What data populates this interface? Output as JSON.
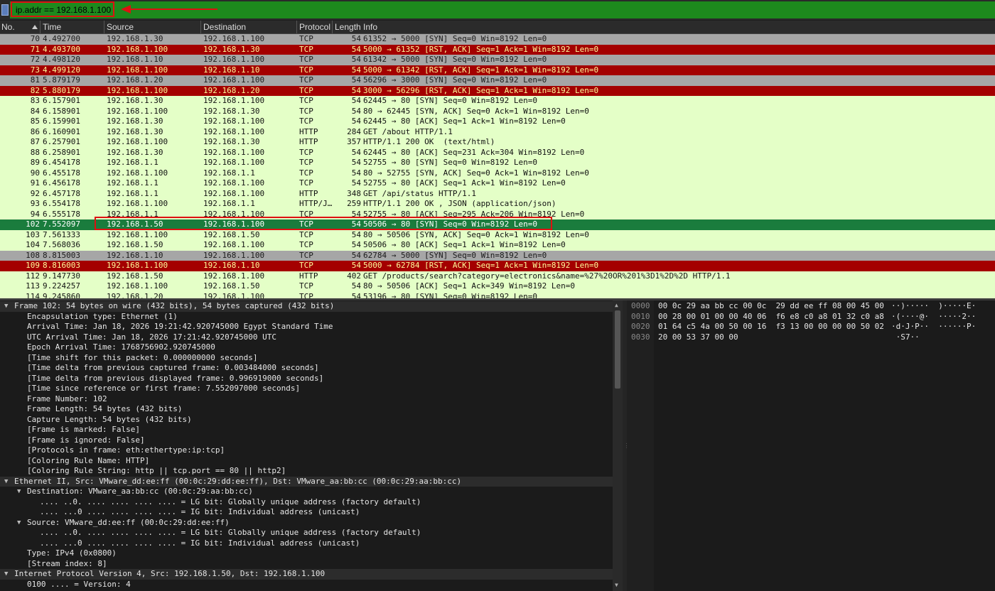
{
  "filter": {
    "value": "ip.addr == 192.168.1.100"
  },
  "columns": {
    "no": "No.",
    "time": "Time",
    "source": "Source",
    "destination": "Destination",
    "protocol": "Protocol",
    "length": "Length",
    "info": "Info"
  },
  "colors": {
    "tcp_flag_bg": "#a6a6a6",
    "tcp_flag_fg": "#1b1b1b",
    "rst_bg": "#a40000",
    "rst_fg": "#fffc9c",
    "http_bg": "#e4ffc7",
    "http_fg": "#121212",
    "selected_bg": "#1a7c3d",
    "selected_fg": "#ffffff"
  },
  "packets": [
    {
      "no": "70",
      "time": "4.492700",
      "src": "192.168.1.30",
      "dst": "192.168.1.100",
      "proto": "TCP",
      "len": "54",
      "info": "61352 → 5000 [SYN] Seq=0 Win=8192 Len=0",
      "style": "gray"
    },
    {
      "no": "71",
      "time": "4.493700",
      "src": "192.168.1.100",
      "dst": "192.168.1.30",
      "proto": "TCP",
      "len": "54",
      "info": "5000 → 61352 [RST, ACK] Seq=1 Ack=1 Win=8192 Len=0",
      "style": "red"
    },
    {
      "no": "72",
      "time": "4.498120",
      "src": "192.168.1.10",
      "dst": "192.168.1.100",
      "proto": "TCP",
      "len": "54",
      "info": "61342 → 5000 [SYN] Seq=0 Win=8192 Len=0",
      "style": "gray"
    },
    {
      "no": "73",
      "time": "4.499120",
      "src": "192.168.1.100",
      "dst": "192.168.1.10",
      "proto": "TCP",
      "len": "54",
      "info": "5000 → 61342 [RST, ACK] Seq=1 Ack=1 Win=8192 Len=0",
      "style": "red"
    },
    {
      "no": "81",
      "time": "5.879179",
      "src": "192.168.1.20",
      "dst": "192.168.1.100",
      "proto": "TCP",
      "len": "54",
      "info": "56296 → 3000 [SYN] Seq=0 Win=8192 Len=0",
      "style": "gray"
    },
    {
      "no": "82",
      "time": "5.880179",
      "src": "192.168.1.100",
      "dst": "192.168.1.20",
      "proto": "TCP",
      "len": "54",
      "info": "3000 → 56296 [RST, ACK] Seq=1 Ack=1 Win=8192 Len=0",
      "style": "red"
    },
    {
      "no": "83",
      "time": "6.157901",
      "src": "192.168.1.30",
      "dst": "192.168.1.100",
      "proto": "TCP",
      "len": "54",
      "info": "62445 → 80 [SYN] Seq=0 Win=8192 Len=0",
      "style": "green"
    },
    {
      "no": "84",
      "time": "6.158901",
      "src": "192.168.1.100",
      "dst": "192.168.1.30",
      "proto": "TCP",
      "len": "54",
      "info": "80 → 62445 [SYN, ACK] Seq=0 Ack=1 Win=8192 Len=0",
      "style": "green"
    },
    {
      "no": "85",
      "time": "6.159901",
      "src": "192.168.1.30",
      "dst": "192.168.1.100",
      "proto": "TCP",
      "len": "54",
      "info": "62445 → 80 [ACK] Seq=1 Ack=1 Win=8192 Len=0",
      "style": "green"
    },
    {
      "no": "86",
      "time": "6.160901",
      "src": "192.168.1.30",
      "dst": "192.168.1.100",
      "proto": "HTTP",
      "len": "284",
      "info": "GET /about HTTP/1.1",
      "style": "green"
    },
    {
      "no": "87",
      "time": "6.257901",
      "src": "192.168.1.100",
      "dst": "192.168.1.30",
      "proto": "HTTP",
      "len": "357",
      "info": "HTTP/1.1 200 OK  (text/html)",
      "style": "green"
    },
    {
      "no": "88",
      "time": "6.258901",
      "src": "192.168.1.30",
      "dst": "192.168.1.100",
      "proto": "TCP",
      "len": "54",
      "info": "62445 → 80 [ACK] Seq=231 Ack=304 Win=8192 Len=0",
      "style": "green"
    },
    {
      "no": "89",
      "time": "6.454178",
      "src": "192.168.1.1",
      "dst": "192.168.1.100",
      "proto": "TCP",
      "len": "54",
      "info": "52755 → 80 [SYN] Seq=0 Win=8192 Len=0",
      "style": "green"
    },
    {
      "no": "90",
      "time": "6.455178",
      "src": "192.168.1.100",
      "dst": "192.168.1.1",
      "proto": "TCP",
      "len": "54",
      "info": "80 → 52755 [SYN, ACK] Seq=0 Ack=1 Win=8192 Len=0",
      "style": "green"
    },
    {
      "no": "91",
      "time": "6.456178",
      "src": "192.168.1.1",
      "dst": "192.168.1.100",
      "proto": "TCP",
      "len": "54",
      "info": "52755 → 80 [ACK] Seq=1 Ack=1 Win=8192 Len=0",
      "style": "green"
    },
    {
      "no": "92",
      "time": "6.457178",
      "src": "192.168.1.1",
      "dst": "192.168.1.100",
      "proto": "HTTP",
      "len": "348",
      "info": "GET /api/status HTTP/1.1",
      "style": "green"
    },
    {
      "no": "93",
      "time": "6.554178",
      "src": "192.168.1.100",
      "dst": "192.168.1.1",
      "proto": "HTTP/J…",
      "len": "259",
      "info": "HTTP/1.1 200 OK , JSON (application/json)",
      "style": "green"
    },
    {
      "no": "94",
      "time": "6.555178",
      "src": "192.168.1.1",
      "dst": "192.168.1.100",
      "proto": "TCP",
      "len": "54",
      "info": "52755 → 80 [ACK] Seq=295 Ack=206 Win=8192 Len=0",
      "style": "green"
    },
    {
      "no": "102",
      "time": "7.552097",
      "src": "192.168.1.50",
      "dst": "192.168.1.100",
      "proto": "TCP",
      "len": "54",
      "info": "50506 → 80 [SYN] Seq=0 Win=8192 Len=0",
      "style": "selected"
    },
    {
      "no": "103",
      "time": "7.561333",
      "src": "192.168.1.100",
      "dst": "192.168.1.50",
      "proto": "TCP",
      "len": "54",
      "info": "80 → 50506 [SYN, ACK] Seq=0 Ack=1 Win=8192 Len=0",
      "style": "green"
    },
    {
      "no": "104",
      "time": "7.568036",
      "src": "192.168.1.50",
      "dst": "192.168.1.100",
      "proto": "TCP",
      "len": "54",
      "info": "50506 → 80 [ACK] Seq=1 Ack=1 Win=8192 Len=0",
      "style": "green"
    },
    {
      "no": "108",
      "time": "8.815003",
      "src": "192.168.1.10",
      "dst": "192.168.1.100",
      "proto": "TCP",
      "len": "54",
      "info": "62784 → 5000 [SYN] Seq=0 Win=8192 Len=0",
      "style": "gray"
    },
    {
      "no": "109",
      "time": "8.816003",
      "src": "192.168.1.100",
      "dst": "192.168.1.10",
      "proto": "TCP",
      "len": "54",
      "info": "5000 → 62784 [RST, ACK] Seq=1 Ack=1 Win=8192 Len=0",
      "style": "red"
    },
    {
      "no": "112",
      "time": "9.147730",
      "src": "192.168.1.50",
      "dst": "192.168.1.100",
      "proto": "HTTP",
      "len": "402",
      "info": "GET /products/search?category=electronics&name=%27%20OR%201%3D1%2D%2D HTTP/1.1",
      "style": "green"
    },
    {
      "no": "113",
      "time": "9.224257",
      "src": "192.168.1.100",
      "dst": "192.168.1.50",
      "proto": "TCP",
      "len": "54",
      "info": "80 → 50506 [ACK] Seq=1 Ack=349 Win=8192 Len=0",
      "style": "green"
    },
    {
      "no": "114",
      "time": "9.245860",
      "src": "192.168.1.20",
      "dst": "192.168.1.100",
      "proto": "TCP",
      "len": "54",
      "info": "53196 → 80 [SYN] Seq=0 Win=8192 Len=0",
      "style": "green"
    }
  ],
  "details": [
    {
      "level": 0,
      "expander": "open",
      "header": true,
      "text": "Frame 102: 54 bytes on wire (432 bits), 54 bytes captured (432 bits)"
    },
    {
      "level": 1,
      "text": "Encapsulation type: Ethernet (1)"
    },
    {
      "level": 1,
      "text": "Arrival Time: Jan 18, 2026 19:21:42.920745000 Egypt Standard Time"
    },
    {
      "level": 1,
      "text": "UTC Arrival Time: Jan 18, 2026 17:21:42.920745000 UTC"
    },
    {
      "level": 1,
      "text": "Epoch Arrival Time: 1768756902.920745000"
    },
    {
      "level": 1,
      "text": "[Time shift for this packet: 0.000000000 seconds]"
    },
    {
      "level": 1,
      "text": "[Time delta from previous captured frame: 0.003484000 seconds]"
    },
    {
      "level": 1,
      "text": "[Time delta from previous displayed frame: 0.996919000 seconds]"
    },
    {
      "level": 1,
      "text": "[Time since reference or first frame: 7.552097000 seconds]"
    },
    {
      "level": 1,
      "text": "Frame Number: 102"
    },
    {
      "level": 1,
      "text": "Frame Length: 54 bytes (432 bits)"
    },
    {
      "level": 1,
      "text": "Capture Length: 54 bytes (432 bits)"
    },
    {
      "level": 1,
      "text": "[Frame is marked: False]"
    },
    {
      "level": 1,
      "text": "[Frame is ignored: False]"
    },
    {
      "level": 1,
      "text": "[Protocols in frame: eth:ethertype:ip:tcp]"
    },
    {
      "level": 1,
      "text": "[Coloring Rule Name: HTTP]"
    },
    {
      "level": 1,
      "text": "[Coloring Rule String: http || tcp.port == 80 || http2]"
    },
    {
      "level": 0,
      "expander": "open",
      "header": true,
      "text": "Ethernet II, Src: VMware_dd:ee:ff (00:0c:29:dd:ee:ff), Dst: VMware_aa:bb:cc (00:0c:29:aa:bb:cc)"
    },
    {
      "level": 1,
      "expander": "open",
      "text": "Destination: VMware_aa:bb:cc (00:0c:29:aa:bb:cc)"
    },
    {
      "level": 2,
      "text": ".... ..0. .... .... .... .... = LG bit: Globally unique address (factory default)"
    },
    {
      "level": 2,
      "text": ".... ...0 .... .... .... .... = IG bit: Individual address (unicast)"
    },
    {
      "level": 1,
      "expander": "open",
      "text": "Source: VMware_dd:ee:ff (00:0c:29:dd:ee:ff)"
    },
    {
      "level": 2,
      "text": ".... ..0. .... .... .... .... = LG bit: Globally unique address (factory default)"
    },
    {
      "level": 2,
      "text": ".... ...0 .... .... .... .... = IG bit: Individual address (unicast)"
    },
    {
      "level": 1,
      "text": "Type: IPv4 (0x0800)"
    },
    {
      "level": 1,
      "text": "[Stream index: 8]"
    },
    {
      "level": 0,
      "expander": "open",
      "header": true,
      "text": "Internet Protocol Version 4, Src: 192.168.1.50, Dst: 192.168.1.100"
    },
    {
      "level": 1,
      "text": "0100 .... = Version: 4"
    }
  ],
  "hex": [
    {
      "offset": "0000",
      "bytes": "00 0c 29 aa bb cc 00 0c  29 dd ee ff 08 00 45 00",
      "ascii": "··)·····  )·····E·"
    },
    {
      "offset": "0010",
      "bytes": "00 28 00 01 00 00 40 06  f6 e8 c0 a8 01 32 c0 a8",
      "ascii": "·(····@·  ·····2··"
    },
    {
      "offset": "0020",
      "bytes": "01 64 c5 4a 00 50 00 16  f3 13 00 00 00 00 50 02",
      "ascii": "·d·J·P··  ······P·"
    },
    {
      "offset": "0030",
      "bytes": "20 00 53 37 00 00",
      "ascii": " ·S7··"
    }
  ]
}
